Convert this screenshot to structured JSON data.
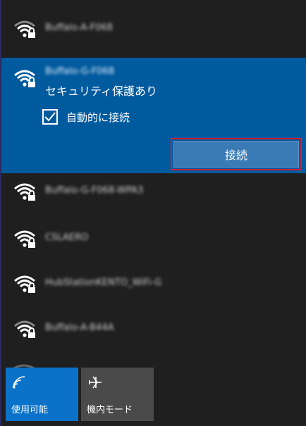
{
  "networks": [
    {
      "ssid": "Buffalo-A-F068",
      "selected": false
    },
    {
      "ssid": "Buffalo-G-F068",
      "selected": true,
      "status": "セキュリティ保護あり"
    },
    {
      "ssid": "Buffalo-G-F068-WPA3",
      "selected": false
    },
    {
      "ssid": "CSLAERO",
      "selected": false
    },
    {
      "ssid": "HubStationKENTO_WiFi-G",
      "selected": false
    },
    {
      "ssid": "Buffalo-A-B44A",
      "selected": false
    }
  ],
  "selected_network": {
    "auto_connect_label": "自動的に接続",
    "auto_connect_checked": true,
    "connect_label": "接続"
  },
  "quick_tiles": [
    {
      "label": "使用可能",
      "icon": "wifi-icon",
      "active": true
    },
    {
      "label": "機内モード",
      "icon": "airplane-icon",
      "active": false
    }
  ],
  "colors": {
    "background": "#1f1f1f",
    "selected_row": "#005a9e",
    "connect_button": "#3a7bb5",
    "highlight_border": "#d21c2e",
    "tile_active": "#0a72c9",
    "tile_inactive": "#4a4a4a"
  }
}
